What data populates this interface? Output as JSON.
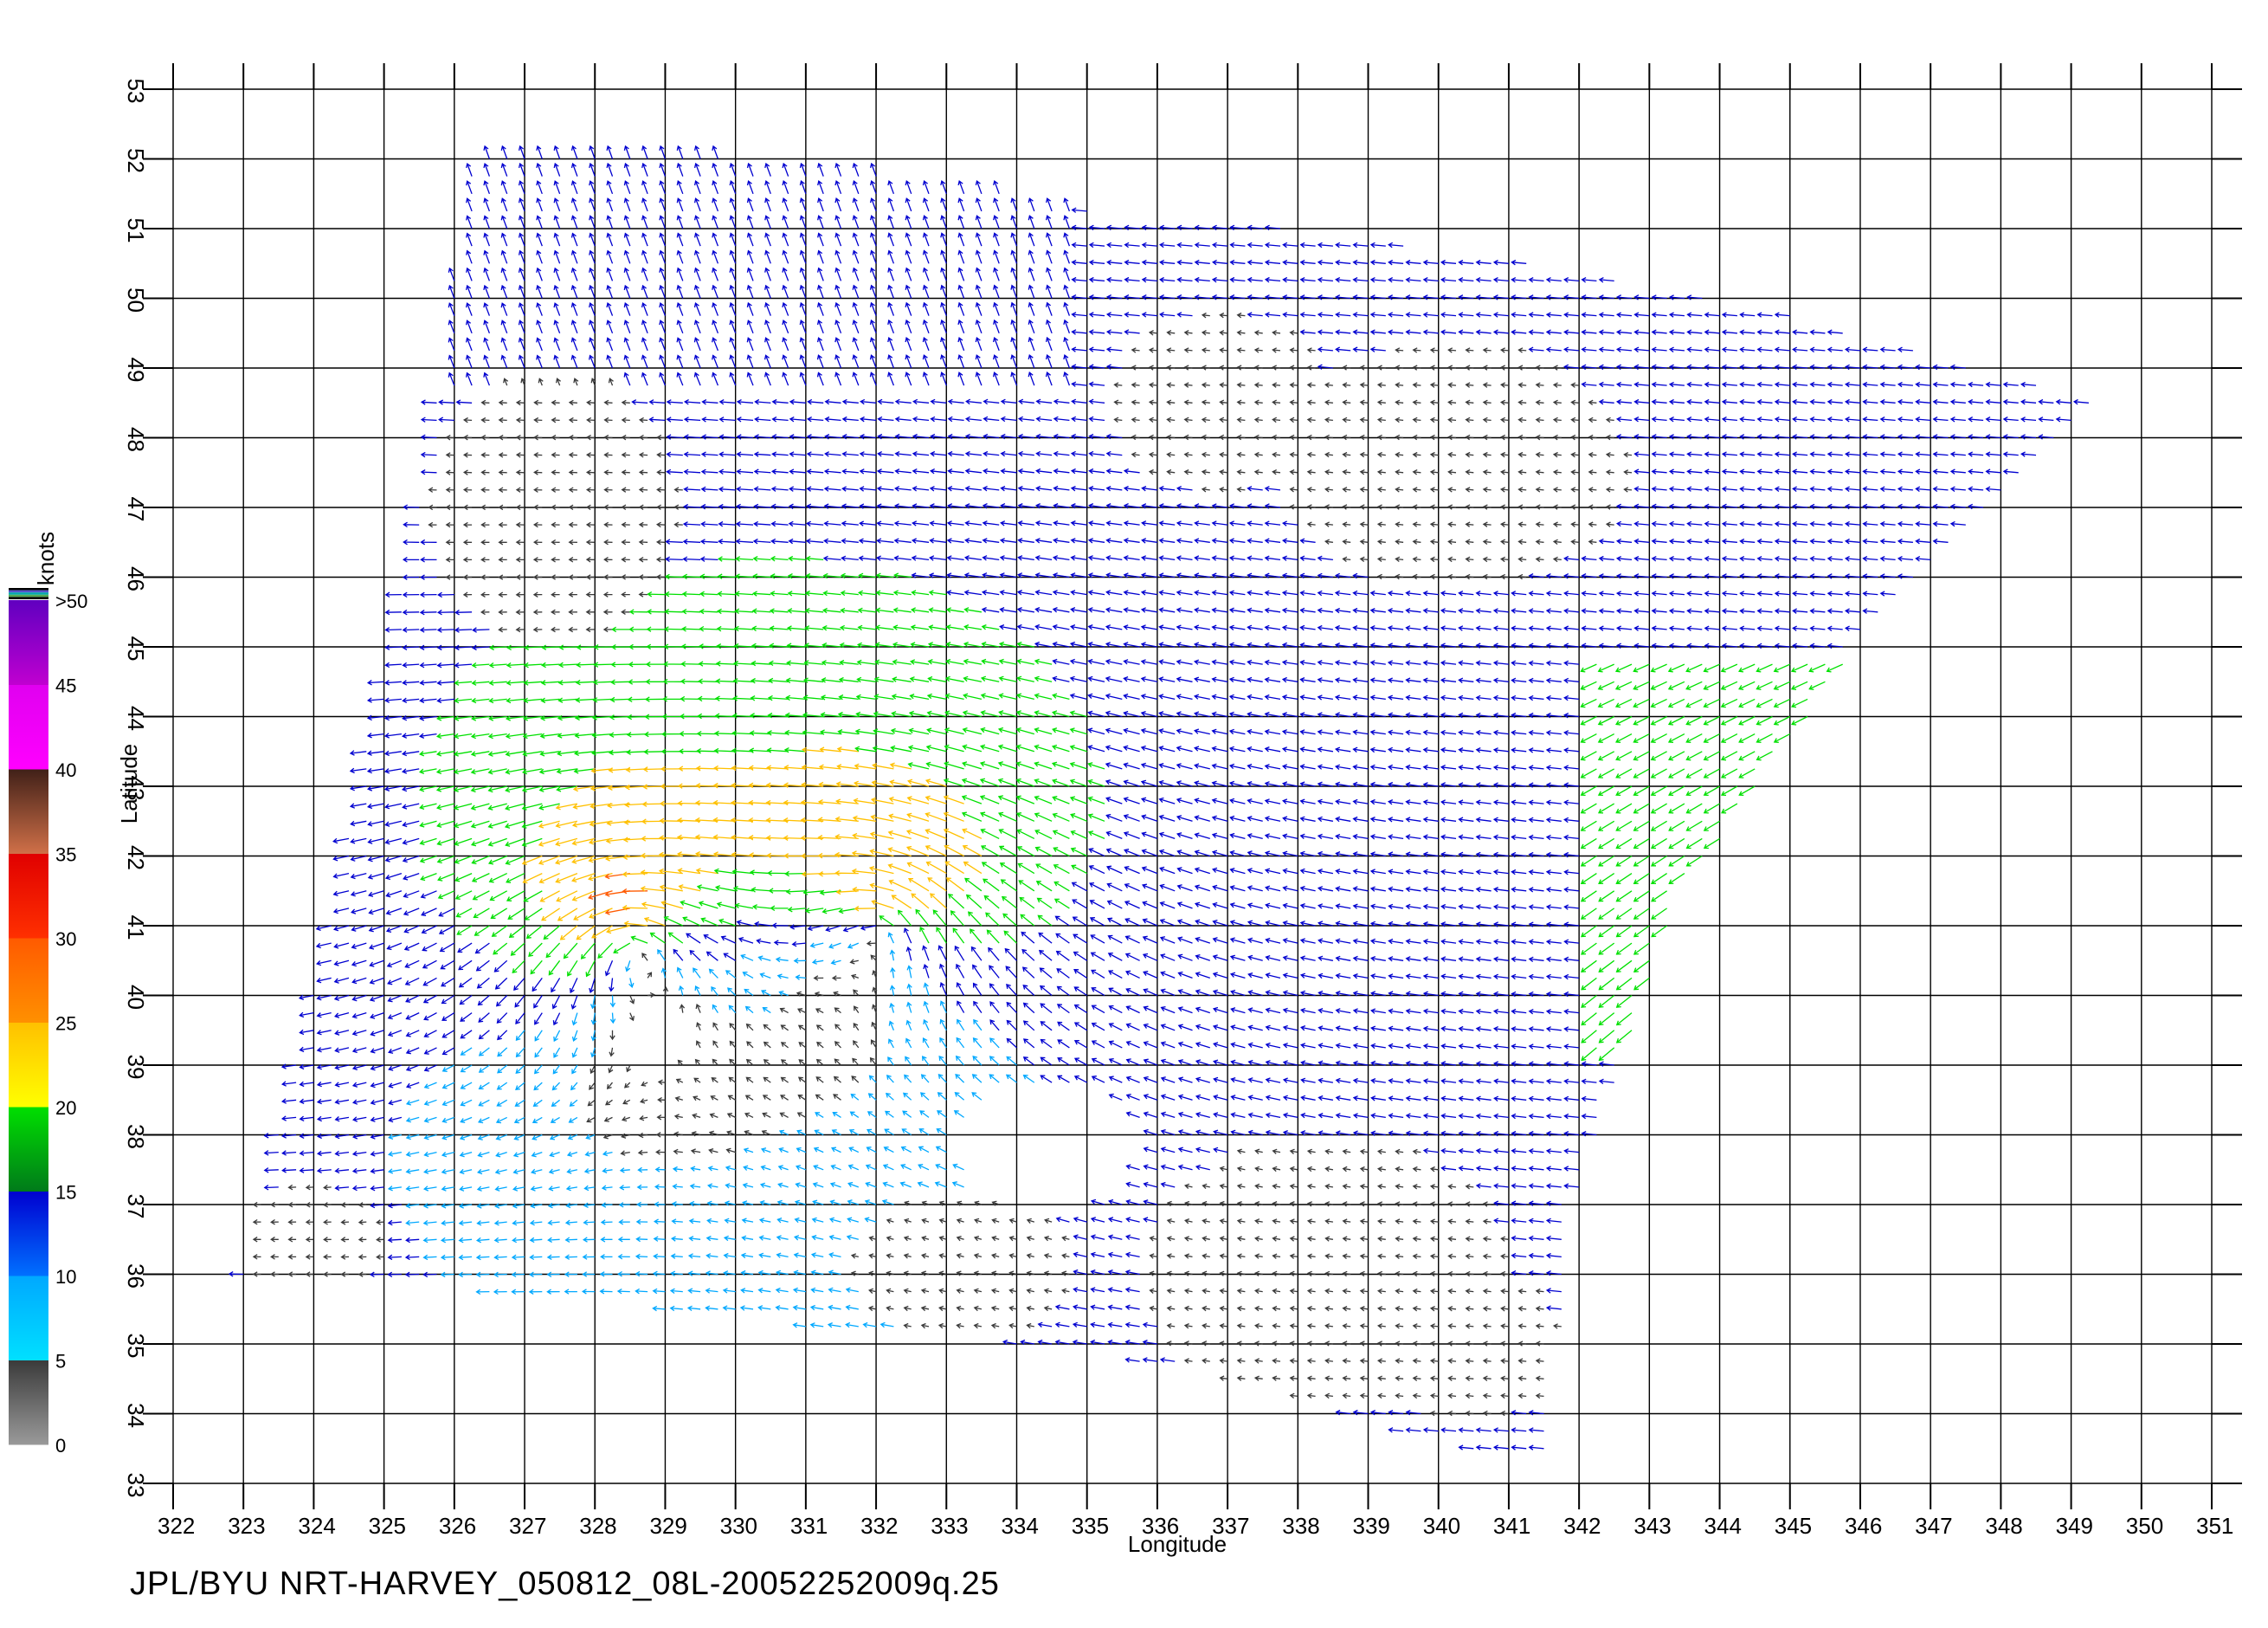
{
  "caption": "JPL/BYU  NRT-HARVEY_050812_08L-20052252009q.25",
  "chart_data": {
    "type": "vector-field",
    "xlabel": "Longitude",
    "ylabel": "Latitude",
    "xlim": [
      322,
      351
    ],
    "ylim": [
      33,
      53
    ],
    "x_ticks": [
      "322",
      "323",
      "324",
      "325",
      "326",
      "327",
      "328",
      "329",
      "330",
      "331",
      "332",
      "333",
      "334",
      "335",
      "336",
      "337",
      "338",
      "339",
      "340",
      "341",
      "342",
      "343",
      "344",
      "345",
      "346",
      "347",
      "348",
      "349",
      "350",
      "351"
    ],
    "y_ticks": [
      "33",
      "34",
      "35",
      "36",
      "37",
      "38",
      "39",
      "40",
      "41",
      "42",
      "43",
      "44",
      "45",
      "46",
      "47",
      "48",
      "49",
      "50",
      "51",
      "52",
      "53"
    ],
    "grid": true,
    "colorbar": {
      "title": "knots",
      "labels": [
        "0",
        "5",
        "10",
        "15",
        "20",
        "25",
        "30",
        "35",
        "40",
        "45",
        ">50"
      ],
      "segments": [
        {
          "from": 0,
          "to": 5,
          "color_low": "#9a9a9a",
          "color_high": "#3a3a3a"
        },
        {
          "from": 5,
          "to": 10,
          "color_low": "#00e0ff",
          "color_high": "#00a8ff"
        },
        {
          "from": 10,
          "to": 15,
          "color_low": "#0070ff",
          "color_high": "#0000d0"
        },
        {
          "from": 15,
          "to": 20,
          "color_low": "#007a1a",
          "color_high": "#00e000"
        },
        {
          "from": 20,
          "to": 25,
          "color_low": "#ffff00",
          "color_high": "#ffc000"
        },
        {
          "from": 25,
          "to": 30,
          "color_low": "#ff9000",
          "color_high": "#ff5a00"
        },
        {
          "from": 30,
          "to": 35,
          "color_low": "#ff3000",
          "color_high": "#e00000"
        },
        {
          "from": 35,
          "to": 40,
          "color_low": "#d07048",
          "color_high": "#402018"
        },
        {
          "from": 40,
          "to": 45,
          "color_low": "#ff00ff",
          "color_high": "#e000f0"
        },
        {
          "from": 45,
          "to": 50,
          "color_low": "#c000d0",
          "color_high": "#6000c0"
        }
      ]
    },
    "swath_outline": [
      [
        326.3,
        52.2
      ],
      [
        328.2,
        52.2
      ],
      [
        330,
        52
      ],
      [
        333.5,
        51.6
      ],
      [
        335.5,
        51.2
      ],
      [
        338,
        51
      ],
      [
        341.5,
        50.5
      ],
      [
        345,
        49.8
      ],
      [
        347,
        49.2
      ],
      [
        349.5,
        48.5
      ],
      [
        346,
        45
      ],
      [
        343.5,
        41.5
      ],
      [
        342,
        37
      ],
      [
        341.5,
        33.3
      ],
      [
        340,
        33.6
      ],
      [
        338,
        34.2
      ],
      [
        336,
        34.7
      ],
      [
        334,
        35
      ],
      [
        332,
        35.1
      ],
      [
        330,
        35.4
      ],
      [
        328,
        35.6
      ],
      [
        326,
        35.8
      ],
      [
        324,
        36
      ],
      [
        323,
        36
      ],
      [
        324.2,
        41
      ],
      [
        325.5,
        47
      ],
      [
        326.3,
        52.2
      ]
    ],
    "gaps": [
      {
        "center": [
          328.9,
          39.4
        ],
        "radius": [
          0.55,
          0.45
        ]
      },
      {
        "center": [
          334.5,
          37.8
        ],
        "radius": [
          1.3,
          0.9
        ]
      }
    ],
    "circulations": [
      {
        "center": [
          328.6,
          40.7
        ],
        "strength": 17
      },
      {
        "center": [
          332.2,
          41.0
        ],
        "strength": 14
      }
    ],
    "ambient_flow": {
      "u": -12,
      "v": 1
    },
    "calm_regions": [
      {
        "center": [
          340.3,
          47.6
        ],
        "radius": [
          2.5,
          1.8
        ]
      },
      {
        "center": [
          337.0,
          48.5
        ],
        "radius": [
          1.6,
          1.3
        ]
      },
      {
        "center": [
          338.5,
          36.0
        ],
        "radius": [
          2.6,
          2.0
        ]
      },
      {
        "center": [
          333.3,
          36.1
        ],
        "radius": [
          1.6,
          1.1
        ]
      },
      {
        "center": [
          327.5,
          47.0
        ],
        "radius": [
          1.8,
          2.0
        ]
      },
      {
        "center": [
          324.0,
          36.5
        ],
        "radius": [
          1.2,
          0.8
        ]
      },
      {
        "center": [
          340.5,
          35.0
        ],
        "radius": [
          1.3,
          1.2
        ]
      }
    ]
  }
}
